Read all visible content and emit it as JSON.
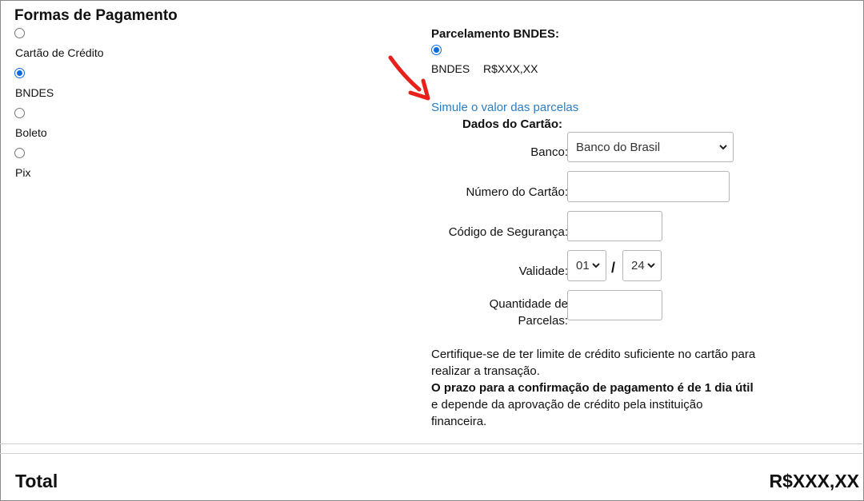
{
  "payment": {
    "title": "Formas de Pagamento",
    "options": [
      {
        "label": "Cartão de Crédito",
        "checked": false
      },
      {
        "label": "BNDES",
        "checked": true
      },
      {
        "label": "Boleto",
        "checked": false
      },
      {
        "label": "Pix",
        "checked": false
      }
    ]
  },
  "bndes": {
    "title": "Parcelamento BNDES:",
    "option_label": "BNDES",
    "option_value": "R$XXX,XX",
    "simulate_link": "Simule o valor das parcelas"
  },
  "card": {
    "title": "Dados do Cartão:",
    "bank_label": "Banco:",
    "bank_value": "Banco do Brasil",
    "number_label": "Número do Cartão:",
    "security_label": "Código de Segurança:",
    "validity_label": "Validade:",
    "validity_month": "01",
    "validity_year": "24",
    "validity_separator": "/",
    "installments_label_line1": "Quantidade de",
    "installments_label_line2": "Parcelas:"
  },
  "info": {
    "line1": "Certifique-se de ter limite de crédito suficiente no cartão para realizar a transação.",
    "bold": "O prazo para a confirmação de pagamento é de 1 dia útil",
    "rest": " e depende da aprovação de crédito pela instituição financeira."
  },
  "total": {
    "label": "Total",
    "value": "R$XXX,XX"
  },
  "colors": {
    "link": "#2a7ec2",
    "radio_checked": "#0b6bdc",
    "arrow": "#e8201c"
  }
}
